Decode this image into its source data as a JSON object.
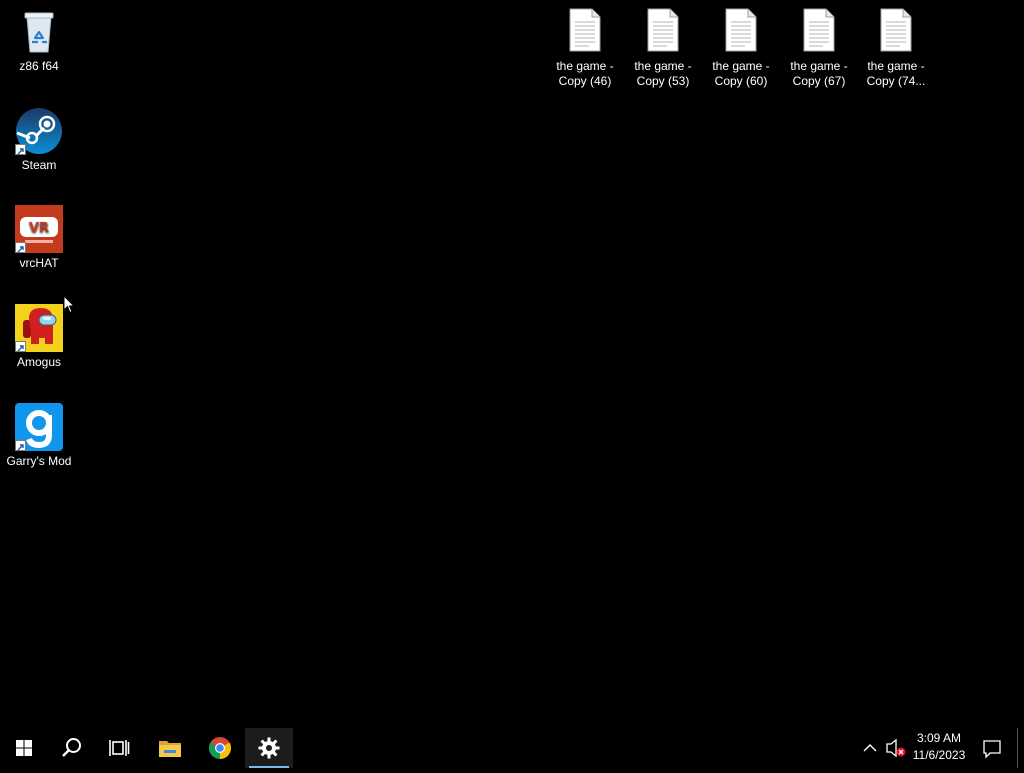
{
  "desktop": {
    "left_icons": [
      {
        "label": "z86 f64",
        "icon": "recycle-bin-icon"
      },
      {
        "label": "Steam",
        "icon": "steam-icon"
      },
      {
        "label": "vrcHAT",
        "icon": "vrchat-icon"
      },
      {
        "label": "Amogus",
        "icon": "among-us-icon"
      },
      {
        "label": "Garry's Mod",
        "icon": "garrys-mod-icon"
      }
    ],
    "file_icons": [
      {
        "line1": "the game -",
        "line2": "Copy (46)",
        "icon": "text-file-icon"
      },
      {
        "line1": "the game -",
        "line2": "Copy (53)",
        "icon": "text-file-icon"
      },
      {
        "line1": "the game -",
        "line2": "Copy (60)",
        "icon": "text-file-icon"
      },
      {
        "line1": "the game -",
        "line2": "Copy (67)",
        "icon": "text-file-icon"
      },
      {
        "line1": "the game -",
        "line2": "Copy (74...",
        "icon": "text-file-icon"
      }
    ],
    "vrchat_logo_text": "VR"
  },
  "taskbar": {
    "pinned": [
      "start-icon",
      "search-icon",
      "task-view-icon",
      "file-explorer-icon",
      "chrome-icon",
      "settings-icon"
    ],
    "active_app": "settings-icon",
    "accent_color": "#76b9ed",
    "clock": {
      "time": "3:09 AM",
      "date": "11/6/2023"
    }
  }
}
